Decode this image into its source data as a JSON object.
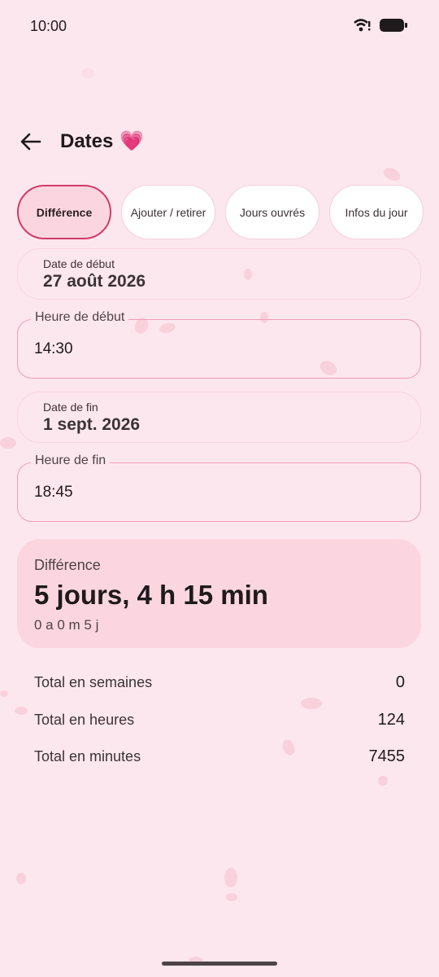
{
  "status_bar": {
    "time": "10:00"
  },
  "app_bar": {
    "title": "Dates",
    "title_emoji": "💗"
  },
  "tabs": [
    {
      "label": "Différence",
      "selected": true
    },
    {
      "label": "Ajouter / retirer",
      "selected": false
    },
    {
      "label": "Jours ouvrés",
      "selected": false
    },
    {
      "label": "Infos du jour",
      "selected": false
    }
  ],
  "start_date": {
    "label": "Date de début",
    "value": "27 août 2026"
  },
  "start_time": {
    "label": "Heure de début",
    "value": "14:30"
  },
  "end_date": {
    "label": "Date de fin",
    "value": "1 sept. 2026"
  },
  "end_time": {
    "label": "Heure de fin",
    "value": "18:45"
  },
  "result": {
    "heading": "Différence",
    "main": "5 jours, 4 h 15 min",
    "sub": "0 a 0 m 5 j"
  },
  "totals": [
    {
      "label": "Total en semaines",
      "value": "0"
    },
    {
      "label": "Total en heures",
      "value": "124"
    },
    {
      "label": "Total en minutes",
      "value": "7455"
    }
  ],
  "colors": {
    "background": "#fde7ee",
    "accent": "#d13b6c",
    "card": "#fbd6e1"
  },
  "icons": {
    "back": "arrow-left-icon",
    "wifi": "wifi-icon",
    "battery": "battery-icon",
    "heart": "heart-emoji-icon"
  }
}
